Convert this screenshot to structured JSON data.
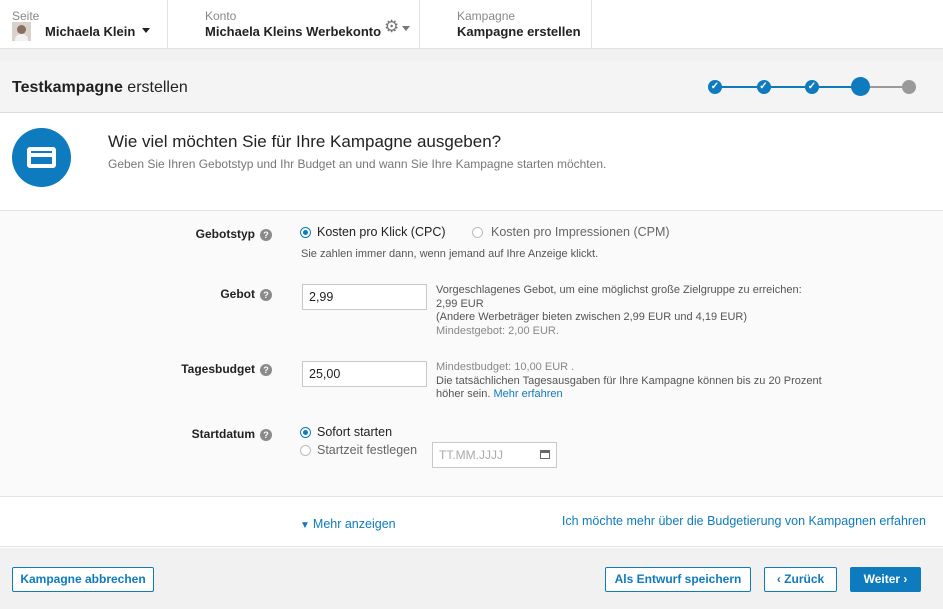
{
  "header": {
    "page": {
      "label": "Seite",
      "value": "Michaela Klein",
      "avatar_icon": "user-avatar"
    },
    "account": {
      "label": "Konto",
      "value": "Michaela Kleins Werbekonto",
      "settings_icon": "gear-icon"
    },
    "campaign": {
      "label": "Kampagne",
      "value": "Kampagne erstellen"
    }
  },
  "titlebar": {
    "title_bold": "Testkampagne",
    "title_rest": " erstellen",
    "progress": {
      "total_steps": 5,
      "completed_steps": 3,
      "current_step": 4
    },
    "check_glyph": "✓"
  },
  "intro": {
    "icon": "credit-card-icon",
    "heading": "Wie viel möchten Sie für Ihre Kampagne ausgeben?",
    "subheading": "Geben Sie Ihren Gebotstyp und Ihr Budget an und wann Sie Ihre Kampagne starten möchten."
  },
  "form": {
    "help_glyph": "?",
    "bid_type": {
      "label": "Gebotstyp",
      "options": [
        {
          "label": "Kosten pro Klick (CPC)",
          "selected": true
        },
        {
          "label": "Kosten pro Impressionen (CPM)",
          "selected": false
        }
      ],
      "note": "Sie zahlen immer dann, wenn jemand auf Ihre Anzeige klickt."
    },
    "bid": {
      "label": "Gebot",
      "value": "2,99",
      "hint_line1": "Vorgeschlagenes Gebot, um eine möglichst große Zielgruppe zu erreichen:",
      "hint_line2": "2,99 EUR",
      "hint_line3": "(Andere Werbeträger bieten zwischen 2,99 EUR und 4,19 EUR)",
      "hint_line4": "Mindestgebot: 2,00 EUR."
    },
    "daily_budget": {
      "label": "Tagesbudget",
      "value": "25,00",
      "hint_line1": "Mindestbudget: 10,00 EUR .",
      "hint_line2": "Die tatsächlichen Tagesausgaben für Ihre Kampagne können bis zu 20 Prozent",
      "hint_line3": "höher sein.",
      "hint_link": "Mehr erfahren"
    },
    "start_date": {
      "label": "Startdatum",
      "options": [
        {
          "label": "Sofort starten",
          "selected": true
        },
        {
          "label": "Startzeit festlegen",
          "selected": false
        }
      ],
      "date_placeholder": "TT.MM.JJJJ",
      "calendar_icon": "calendar-icon"
    }
  },
  "links": {
    "show_more": "Mehr anzeigen",
    "show_more_icon": "chevron-down-icon",
    "learn_more": "Ich möchte mehr über die Budgetierung von Kampagnen erfahren"
  },
  "footer": {
    "cancel": "Kampagne abbrechen",
    "save_draft": "Als Entwurf speichern",
    "back": "‹ Zurück",
    "next": "Weiter ›"
  },
  "colors": {
    "accent": "#0e7bbf",
    "pending_step": "#9a9a9a"
  }
}
